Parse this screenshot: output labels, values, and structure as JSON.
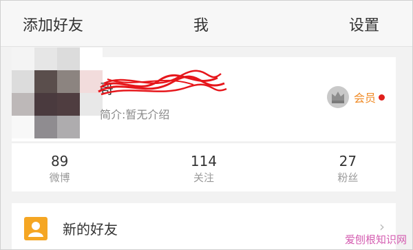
{
  "header": {
    "left": "添加好友",
    "title": "我",
    "right": "设置"
  },
  "profile": {
    "name_visible": "哥",
    "intro": "简介:暂无介绍",
    "member_label": "会员"
  },
  "stats": [
    {
      "value": "89",
      "label": "微博"
    },
    {
      "value": "114",
      "label": "关注"
    },
    {
      "value": "27",
      "label": "粉丝"
    }
  ],
  "list": {
    "new_friends": "新的好友",
    "chevron": "›"
  },
  "watermark": {
    "text": "爱刨根知识网"
  },
  "colors": {
    "accent_orange": "#f08a24",
    "badge_red": "#e0201c",
    "icon_orange": "#f5a623"
  },
  "icons": {
    "crown": "crown-icon",
    "friend": "person-icon",
    "chevron": "chevron-right-icon"
  }
}
